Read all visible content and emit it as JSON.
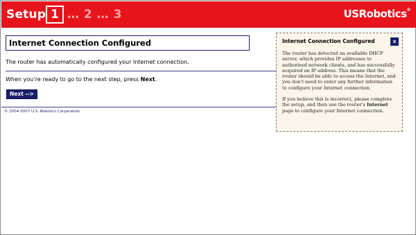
{
  "header": {
    "setup_label": "Setup",
    "current_step": "1",
    "remaining_steps": "… 2 … 3",
    "logo": "USRobotics",
    "logo_mark": "®"
  },
  "main": {
    "title": "Internet Connection Configured",
    "auto_configured_text": "The router has automatically configured your Internet connection.",
    "next_prompt_prefix": "When you’re ready to go to the next step, press ",
    "next_prompt_strong": "Next",
    "next_prompt_suffix": ".",
    "next_button_label": "Next -->",
    "copyright": "© 2004-2007 U.S. Robotics Corporation"
  },
  "help": {
    "title": "Internet Connection Configured",
    "close_label": "x",
    "paragraph_1": "The router has detected an available DHCP server, which provides IP addresses to authorised network clients, and has successfully acquired an IP address. This means that the router should be able to access the Internet, and you don't need to enter any further information to configure your Internet connection.",
    "paragraph_2_prefix": "If you believe this is incorrect, please complete the setup, and then use the router's ",
    "paragraph_2_strong": "Internet",
    "paragraph_2_suffix": " page to configure your Internet connection."
  },
  "colors": {
    "header_red": "#e8141c",
    "navy": "#1b1f6b",
    "help_background": "#fbf5ea"
  }
}
